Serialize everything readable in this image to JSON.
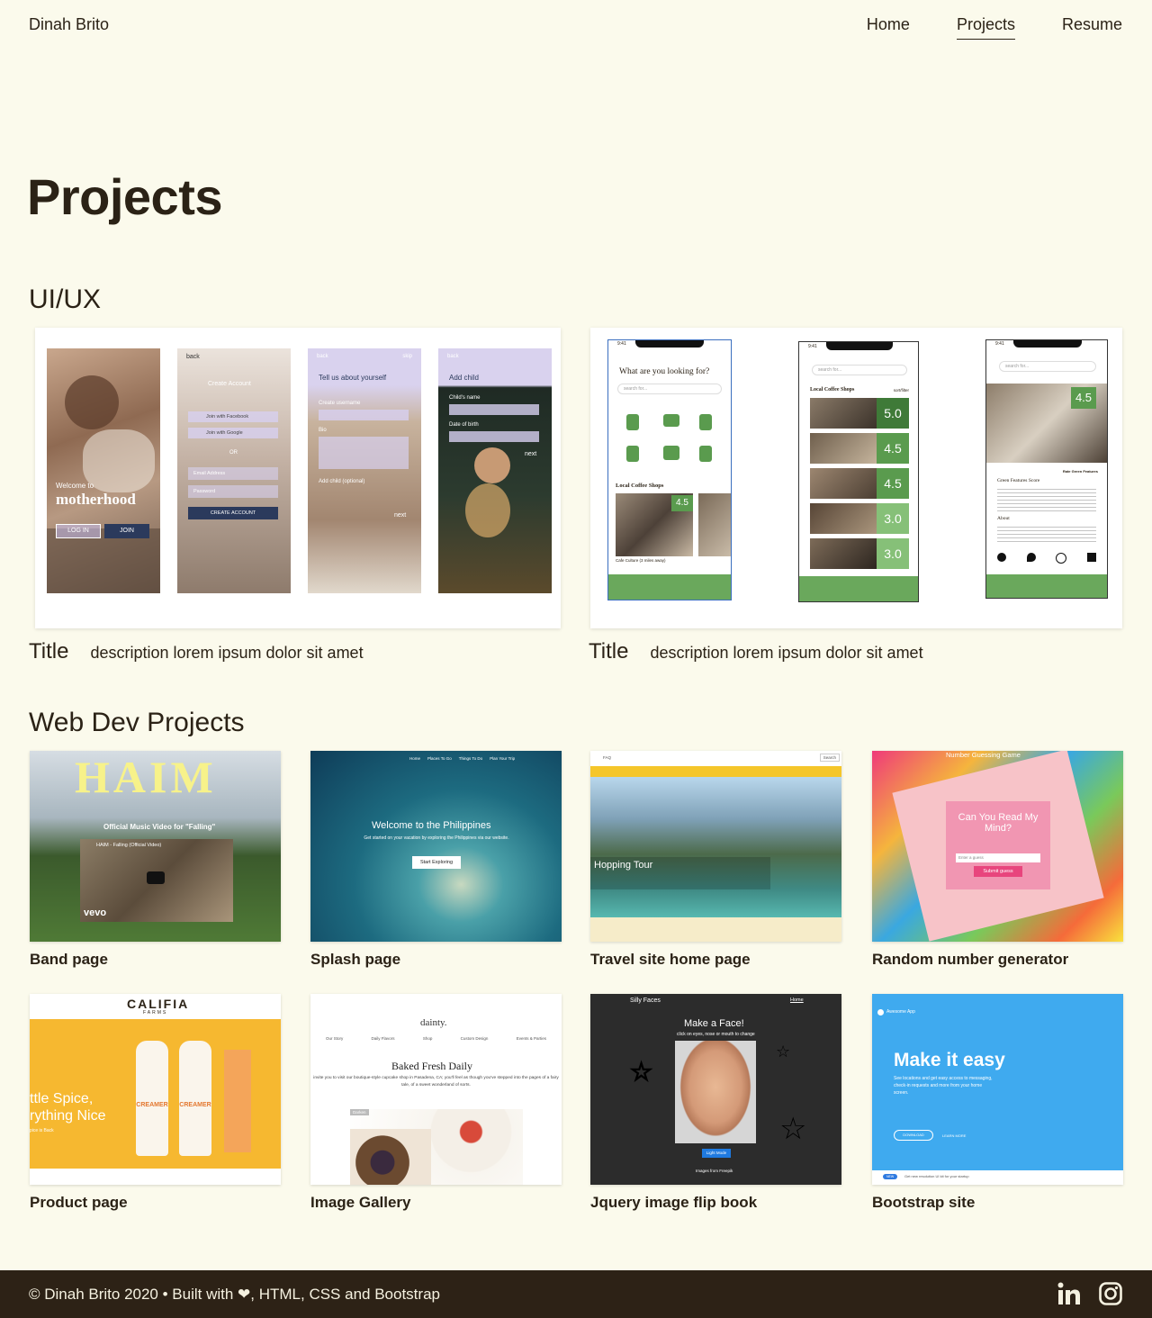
{
  "nav": {
    "brand": "Dinah Brito",
    "links": [
      "Home",
      "Projects",
      "Resume"
    ]
  },
  "page_title": "Projects",
  "uiux": {
    "heading": "UI/UX",
    "cards": [
      {
        "title": "Title",
        "description": "description lorem ipsum dolor sit amet",
        "screens": [
          {
            "overlay_small": "Welcome to",
            "overlay_big": "motherhood",
            "btn1": "LOG IN",
            "btn2": "JOIN"
          },
          {
            "back": "back",
            "heading": "Create Account",
            "fb": "Join with Facebook",
            "google": "Join with Google",
            "or": "OR",
            "email": "Email Address",
            "password": "Password",
            "submit": "CREATE ACCOUNT"
          },
          {
            "back": "back",
            "skip": "skip",
            "heading": "Tell us about yourself",
            "f1": "Create username",
            "f2": "Bio",
            "f3": "Add child (optional)",
            "next": "next"
          },
          {
            "back": "back",
            "heading": "Add child",
            "f1": "Child's name",
            "f2": "Date of birth",
            "next": "next"
          }
        ]
      },
      {
        "title": "Title",
        "description": "description lorem ipsum dolor sit amet",
        "screens": [
          {
            "time": "9:41",
            "question": "What are you looking for?",
            "search": "search for...",
            "section": "Local Coffee Shops",
            "score": "4.5",
            "caption": "Cafe Culture (3 miles away)"
          },
          {
            "time": "9:41",
            "search": "search for...",
            "section": "Local Coffee Shops",
            "filter": "sort/filter",
            "scores": [
              "5.0",
              "4.5",
              "4.5",
              "3.0",
              "3.0"
            ]
          },
          {
            "time": "9:41",
            "search": "search for...",
            "score": "4.5",
            "rate": "Rate Green Features",
            "heading": "Green Features Score",
            "about": "About"
          }
        ]
      }
    ]
  },
  "webdev": {
    "heading": "Web Dev Projects",
    "items": [
      {
        "label": "Band page",
        "thumb_title": "HAIM",
        "thumb_caption": "Official Music Video for \"Falling\"",
        "thumb_video": "HAIM - Falling (Official Video)",
        "thumb_logo": "vevo"
      },
      {
        "label": "Splash page",
        "thumb_title": "Welcome to the Philippines",
        "thumb_caption": "Get started on your vacation by exploring the Philippines via our website.",
        "thumb_button": "Start Exploring",
        "thumb_nav": [
          "Home",
          "Places To Go",
          "Things To Do",
          "Plan Your Trip"
        ]
      },
      {
        "label": "Travel site home page",
        "thumb_title": "Hopping Tour",
        "thumb_search": "Search",
        "thumb_nav": "FAQ"
      },
      {
        "label": "Random number generator",
        "thumb_header": "Number Guessing Game",
        "thumb_title": "Can You Read My Mind?",
        "thumb_input": "Enter a guess",
        "thumb_button": "Submit guess"
      },
      {
        "label": "Product page",
        "thumb_brand": "CALIFIA",
        "thumb_brand_sub": "FARMS",
        "thumb_line1": "ttle Spice,",
        "thumb_line2": "rything Nice",
        "thumb_line3": "pice is Back",
        "thumb_product": "CREAMER"
      },
      {
        "label": "Image Gallery",
        "thumb_brand": "dainty.",
        "thumb_nav": [
          "Our Story",
          "Daily Flavors",
          "Shop",
          "Custom Design",
          "Events & Parties"
        ],
        "thumb_title": "Baked Fresh Daily",
        "thumb_body": "invite you to visit our boutique-style cupcake shop in Pasadena, CA; you'll feel as though you've stepped into the pages of a fairy tale, of a sweet wonderland of sorts.",
        "thumb_tag": "Darken"
      },
      {
        "label": "Jquery image flip book",
        "thumb_brand": "Silly Faces",
        "thumb_nav": "Home",
        "thumb_title": "Make a Face!",
        "thumb_sub": "click on eyes, nose or mouth to change",
        "thumb_button": "Light Mode",
        "thumb_credit": "Images from Freepik"
      },
      {
        "label": "Bootstrap site",
        "thumb_brand": "Awesome App",
        "thumb_title": "Make it easy",
        "thumb_body": "See locations and get easy access to messaging, check-in requests and more from your home screen.",
        "thumb_btn1": "DOWNLOAD",
        "thumb_btn2": "LEARN MORE",
        "thumb_badge": "NEW",
        "thumb_footer": "Get new resolution UI kit for your startup"
      }
    ]
  },
  "footer": {
    "text": "© Dinah Brito 2020 • Built with ❤, HTML, CSS and Bootstrap"
  }
}
